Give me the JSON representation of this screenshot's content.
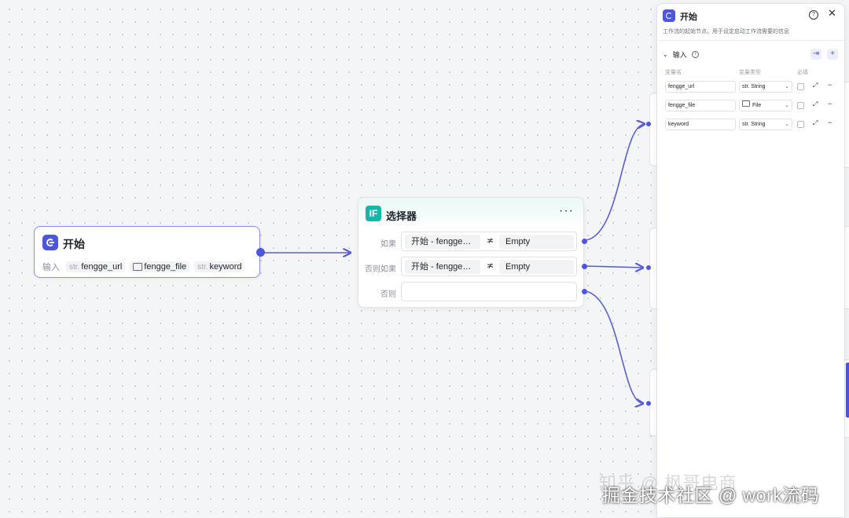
{
  "start_node": {
    "title": "开始",
    "input_label": "输入",
    "params": [
      {
        "prefix": "str.",
        "name": "fengge_url"
      },
      {
        "prefix": "",
        "name": "fengge_file",
        "icon": "folder-icon"
      },
      {
        "prefix": "str.",
        "name": "keyword"
      }
    ]
  },
  "selector_node": {
    "icon_text": "IF",
    "title": "选择器",
    "more": "···",
    "conditions": [
      {
        "label": "如果",
        "left": "开始 - fengge…",
        "operator": "≭",
        "right": "Empty"
      },
      {
        "label": "否则如果",
        "left": "开始 - fengge…",
        "operator": "≭",
        "right": "Empty"
      },
      {
        "label": "否则",
        "left": "",
        "operator": "",
        "right": ""
      }
    ]
  },
  "panel": {
    "title": "开始",
    "description": "工作流的起始节点，用于设定启动工作流需要的信息",
    "section": "输入",
    "columns": {
      "name": "变量名",
      "type": "变量类型",
      "required": "必填"
    },
    "rows": [
      {
        "name": "fengge_url",
        "type": "str. String"
      },
      {
        "name": "fengge_file",
        "type": "File"
      },
      {
        "name": "keyword",
        "type": "str. String"
      }
    ]
  },
  "watermark": {
    "line1": "知乎 @ 枫哥电商",
    "line2": "掘金技术社区 @ work流码"
  },
  "colors": {
    "accent": "#4e56e0",
    "if_icon": "#14b8a6",
    "edge": "#5a5fd0"
  }
}
